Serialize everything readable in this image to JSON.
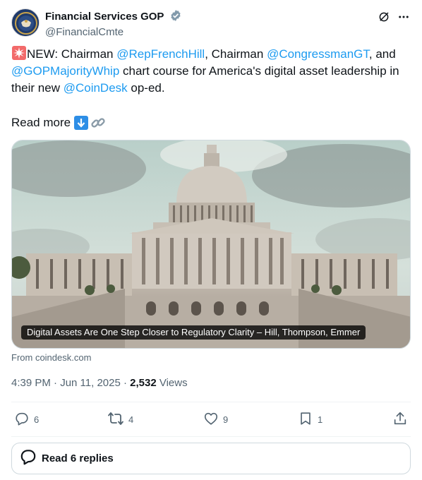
{
  "author": {
    "display_name": "Financial Services GOP",
    "handle": "@FinancialCmte"
  },
  "tweet": {
    "text_parts": [
      "NEW: Chairman ",
      "@RepFrenchHill",
      ", Chairman ",
      "@CongressmanGT",
      ", and ",
      "@GOPMajorityWhip",
      " chart course for America's digital asset leadership in their new ",
      "@CoinDesk",
      " op-ed."
    ],
    "read_more": "Read more"
  },
  "card": {
    "caption": "Digital Assets Are One Step Closer to Regulatory Clarity – Hill, Thompson, Emmer",
    "source": "From coindesk.com"
  },
  "meta": {
    "timestamp": "4:39 PM · Jun 11, 2025 · ",
    "views_count": "2,532",
    "views_label": " Views"
  },
  "actions": {
    "replies": "6",
    "reposts": "4",
    "likes": "9",
    "bookmarks": "1"
  },
  "replies_button": {
    "label": "Read 6 replies"
  },
  "colors": {
    "accent": "#1d9bf0",
    "text": "#0f1419",
    "muted": "#536471"
  }
}
